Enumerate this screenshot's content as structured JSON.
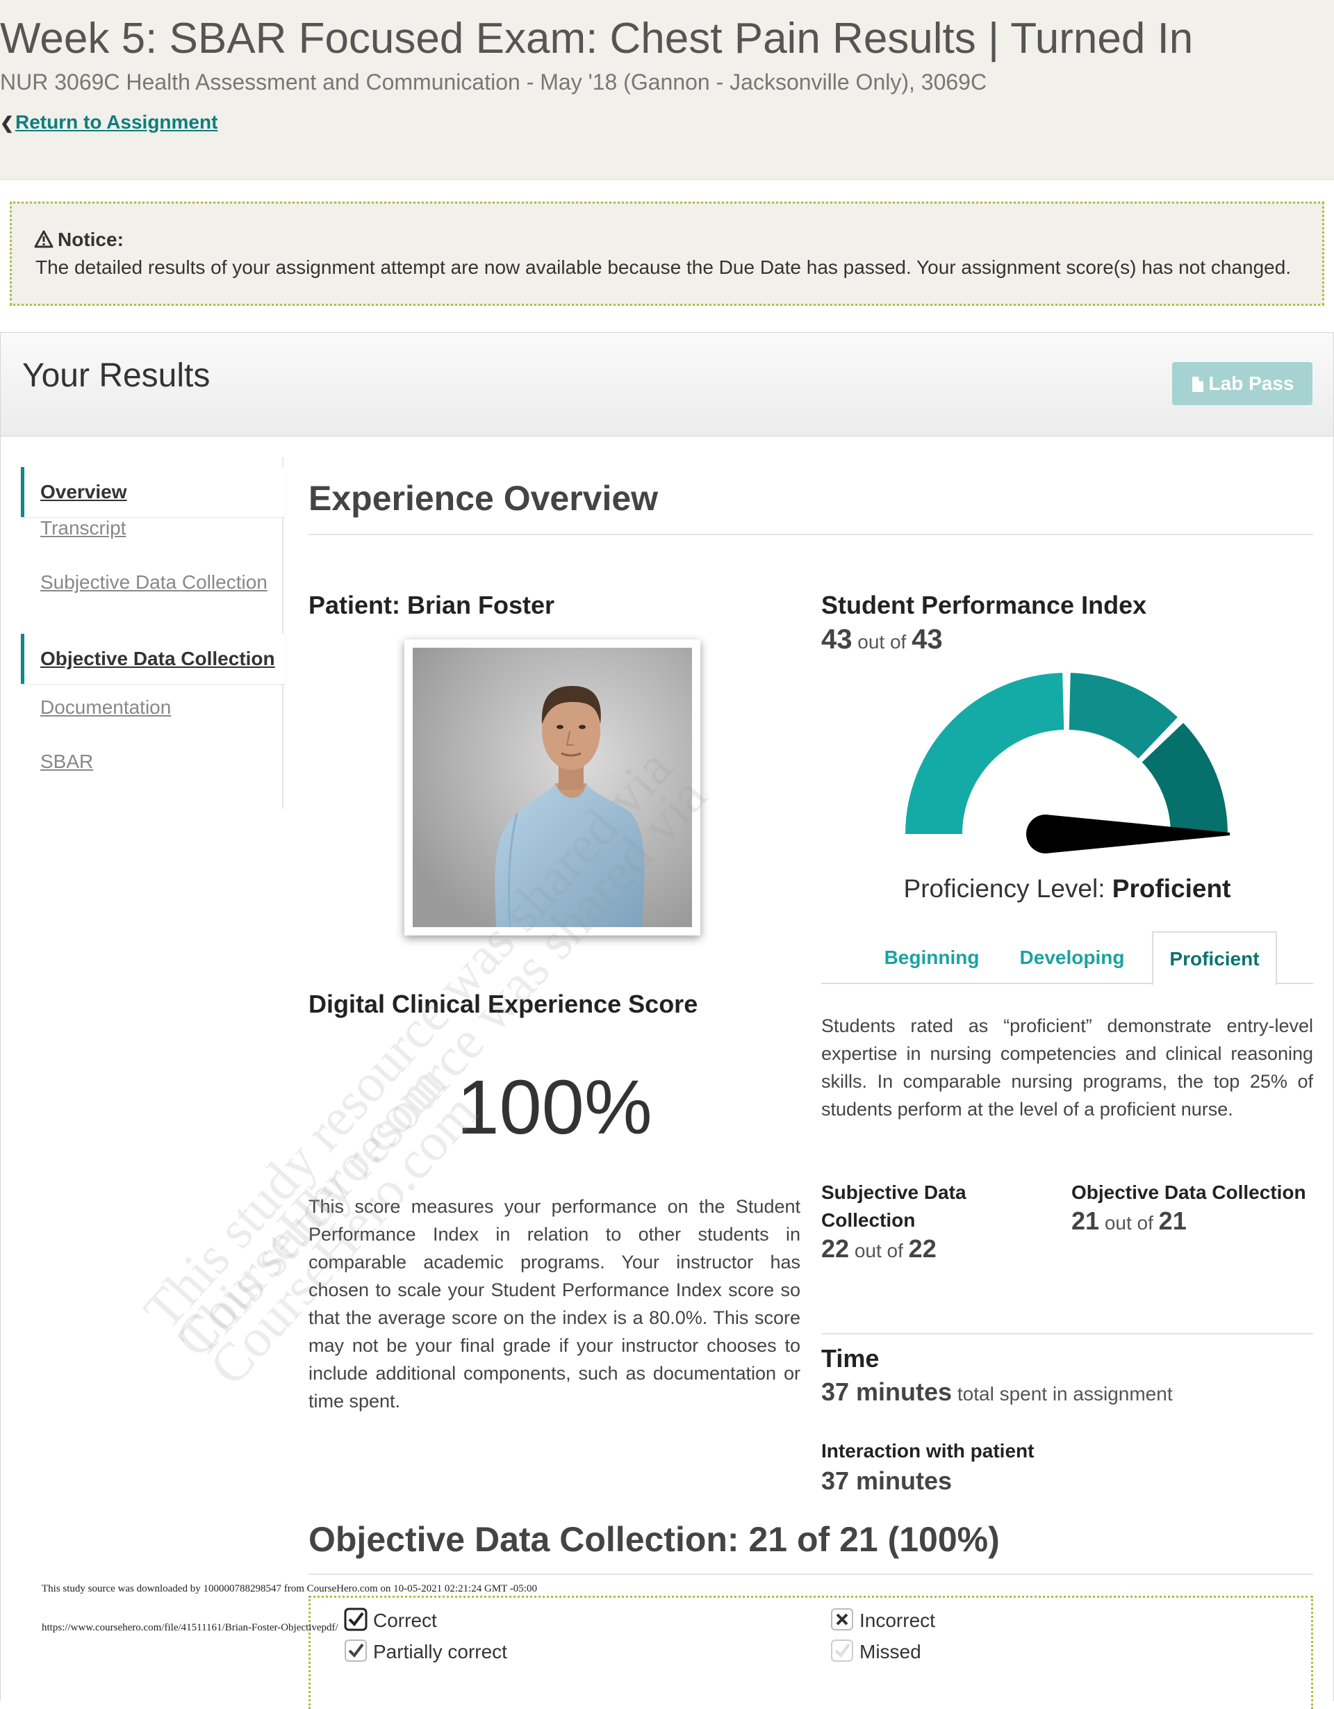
{
  "header": {
    "title": "Week 5: SBAR Focused Exam: Chest Pain Results | Turned In",
    "course": "NUR 3069C Health Assessment and Communication - May '18 (Gannon - Jacksonville Only), 3069C",
    "return_link": "Return to Assignment"
  },
  "notice": {
    "title": "Notice:",
    "body": "The detailed results of your assignment attempt are now available because the Due Date has passed. Your assignment score(s) has not changed."
  },
  "results": {
    "heading": "Your Results",
    "lab_pass_label": "Lab Pass"
  },
  "nav": {
    "items": [
      {
        "label": "Overview",
        "active": true
      },
      {
        "label": "Transcript",
        "active": false
      },
      {
        "label": "Subjective Data Collection",
        "active": false
      },
      {
        "label": "Objective Data Collection",
        "active": true
      },
      {
        "label": "Documentation",
        "active": false
      },
      {
        "label": "SBAR",
        "active": false
      }
    ]
  },
  "overview": {
    "heading": "Experience Overview",
    "patient_label": "Patient: Brian Foster",
    "dce": {
      "heading": "Digital Clinical Experience Score",
      "score": "100%",
      "description": "This score measures your performance on the Student Performance Index in relation to other students in comparable academic programs. Your instructor has chosen to scale your Student Performance Index score so that the average score on the index is a 80.0%. This score may not be your final grade if your instructor chooses to include additional components, such as documentation or time spent."
    },
    "spi": {
      "heading": "Student Performance Index",
      "score": "43",
      "out_of_label": "out of",
      "total": "43",
      "gauge_fraction": 1.0,
      "gauge_colors": [
        "#14aba6",
        "#0e8f8b",
        "#06706c"
      ],
      "proficiency_label": "Proficiency Level:",
      "proficiency_value": "Proficient",
      "tabs": [
        "Beginning",
        "Developing",
        "Proficient"
      ],
      "active_tab": 2,
      "proficient_description": "Students rated as “proficient” demonstrate entry-level expertise in nursing competencies and clinical reasoning skills. In comparable nursing programs, the top 25% of students perform at the level of a proficient nurse."
    },
    "subjective": {
      "label": "Subjective Data Collection",
      "score": "22",
      "out_of_label": "out of",
      "total": "22"
    },
    "objective": {
      "label": "Objective Data Collection",
      "score": "21",
      "out_of_label": "out of",
      "total": "21"
    },
    "time": {
      "heading": "Time",
      "value": "37 minutes",
      "suffix": "total spent in assignment",
      "interaction_label": "Interaction with patient",
      "interaction_value": "37 minutes"
    }
  },
  "objective_section": {
    "heading": "Objective Data Collection: 21 of 21 (100%)",
    "legend": {
      "correct": "Correct",
      "partially_correct": "Partially correct",
      "incorrect": "Incorrect",
      "missed": "Missed"
    }
  },
  "watermark": {
    "line1": "This study resource was shared via",
    "line2": "CourseHero.com"
  },
  "footer": {
    "line1": "This study source was downloaded by 100000788298547 from CourseHero.com on 10-05-2021 02:21:24 GMT -05:00",
    "line2": "https://www.coursehero.com/file/41511161/Brian-Foster-Objectivepdf/"
  }
}
